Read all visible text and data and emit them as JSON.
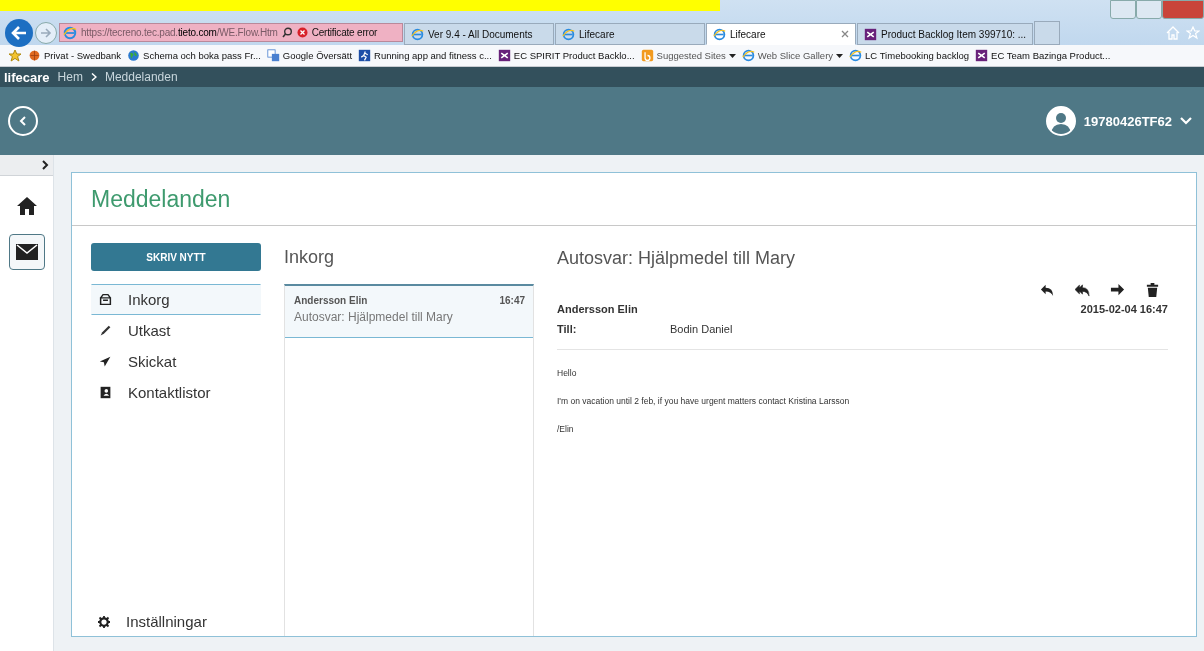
{
  "browser": {
    "address": "https://tecreno.tec.pad.**tieto.com**/WE.Flow.Htm",
    "certificate": "Certificate error",
    "tabs": [
      {
        "label": "Ver 9.4 - All Documents",
        "kind": "ie",
        "selected": false
      },
      {
        "label": "Lifecare",
        "kind": "ie",
        "selected": false
      },
      {
        "label": "Lifecare",
        "kind": "ie",
        "selected": true
      },
      {
        "label": "Product Backlog Item 399710: ...",
        "kind": "vs",
        "selected": false
      }
    ],
    "favorites": [
      {
        "label": "Privat - Swedbank",
        "kind": "bank",
        "dropdown": false
      },
      {
        "label": "Schema och boka pass  Fr...",
        "kind": "globe",
        "dropdown": false
      },
      {
        "label": "Google Översätt",
        "kind": "translate",
        "dropdown": false
      },
      {
        "label": "Running app and fitness c...",
        "kind": "runner",
        "dropdown": false
      },
      {
        "label": "EC SPIRIT Product Backlo...",
        "kind": "vs",
        "dropdown": false
      },
      {
        "label": "Suggested Sites",
        "kind": "suggest",
        "dropdown": true
      },
      {
        "label": "Web Slice Gallery",
        "kind": "ie",
        "dropdown": true
      },
      {
        "label": "LC Timebooking backlog",
        "kind": "ie",
        "dropdown": false
      },
      {
        "label": "EC Team Bazinga Product...",
        "kind": "vs",
        "dropdown": false
      }
    ]
  },
  "app": {
    "brand": "lifecare",
    "breadcrumb": [
      "Hem",
      "Meddelanden"
    ],
    "user": "19780426TF62",
    "rail": [
      {
        "kind": "home",
        "selected": false
      },
      {
        "kind": "mail",
        "selected": true
      }
    ]
  },
  "page": {
    "title": "Meddelanden",
    "compose": "SKRIV NYTT",
    "folders": [
      {
        "label": "Inkorg",
        "kind": "inbox",
        "selected": true
      },
      {
        "label": "Utkast",
        "kind": "pencil",
        "selected": false
      },
      {
        "label": "Skickat",
        "kind": "send",
        "selected": false
      },
      {
        "label": "Kontaktlistor",
        "kind": "contacts",
        "selected": false
      }
    ],
    "settings": "Inställningar",
    "inbox": {
      "heading": "Inkorg",
      "messages": [
        {
          "sender": "Andersson Elin",
          "time": "16:47",
          "subject": "Autosvar: Hjälpmedel till Mary",
          "selected": true
        }
      ]
    },
    "message": {
      "subject": "Autosvar: Hjälpmedel till Mary",
      "actions": [
        {
          "kind": "reply"
        },
        {
          "kind": "reply-all"
        },
        {
          "kind": "forward"
        },
        {
          "kind": "delete"
        }
      ],
      "sender": "Andersson Elin",
      "date": "2015-02-04 16:47",
      "to_label": "Till:",
      "to": "Bodin Daniel",
      "body": [
        "Hello",
        "I'm on vacation until 2 feb, if you have urgent matters contact Kristina Larsson",
        "/Elin"
      ]
    }
  }
}
